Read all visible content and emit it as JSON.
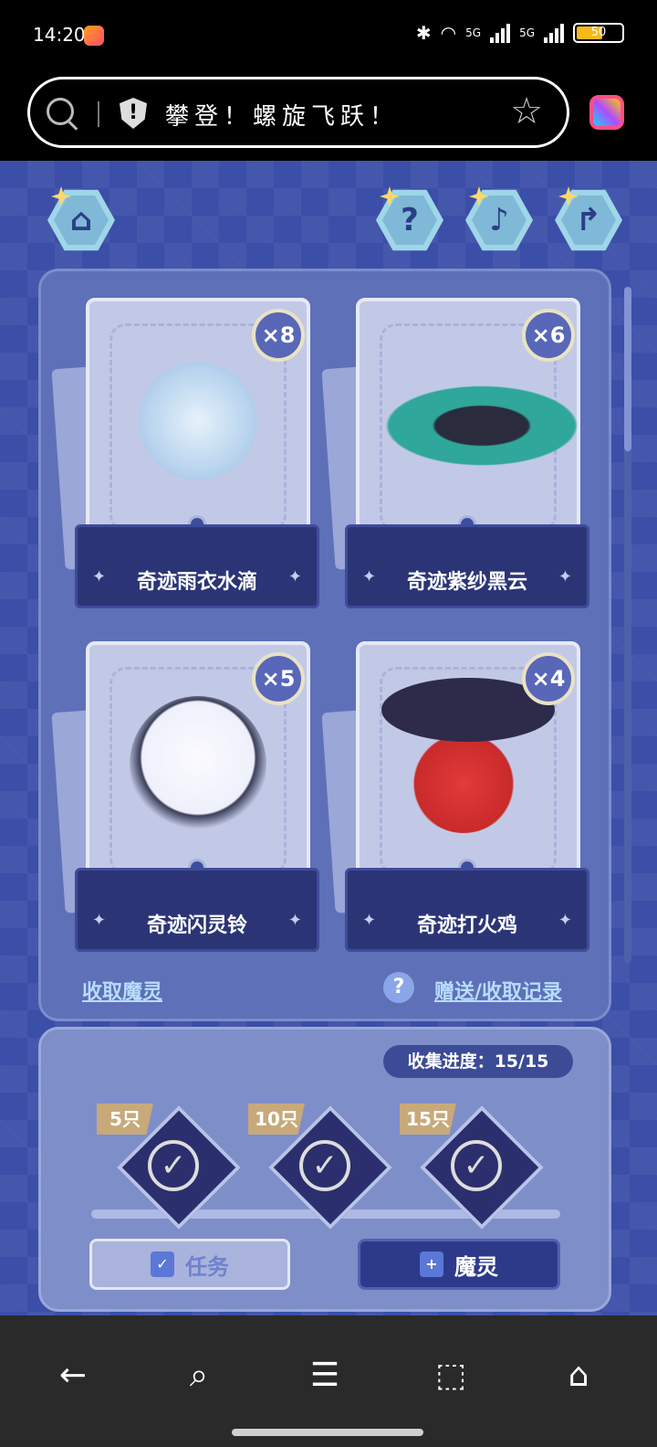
{
  "status_bar": {
    "time": "14:20",
    "network_1": "5G",
    "network_2": "5G",
    "battery": "50"
  },
  "browser": {
    "query": "攀登！螺旋飞跃！"
  },
  "cards": [
    {
      "name": "奇迹雨衣水滴",
      "count": "×8"
    },
    {
      "name": "奇迹紫纱黑云",
      "count": "×6"
    },
    {
      "name": "奇迹闪灵铃",
      "count": "×5"
    },
    {
      "name": "奇迹打火鸡",
      "count": "×4"
    }
  ],
  "links": {
    "collect": "收取魔灵",
    "help": "?",
    "records": "赠送/收取记录"
  },
  "progress": {
    "label": "收集进度：15/15",
    "milestones": [
      {
        "tag": "5只"
      },
      {
        "tag": "10只"
      },
      {
        "tag": "15只"
      }
    ]
  },
  "buttons": {
    "task": "任务",
    "spirit": "魔灵"
  },
  "icons": {
    "home": "home-icon",
    "help": "question-icon",
    "music": "music-icon",
    "share": "share-icon",
    "nav_back": "back-arrow-icon",
    "nav_search": "search-icon",
    "nav_menu": "menu-icon",
    "nav_tabs": "tabs-icon",
    "nav_home": "home-icon"
  },
  "colors": {
    "game_bg": "#3b4ea8",
    "panel": "#5e70b8",
    "plate": "#2b3576",
    "accent_link": "#b8dcff"
  }
}
